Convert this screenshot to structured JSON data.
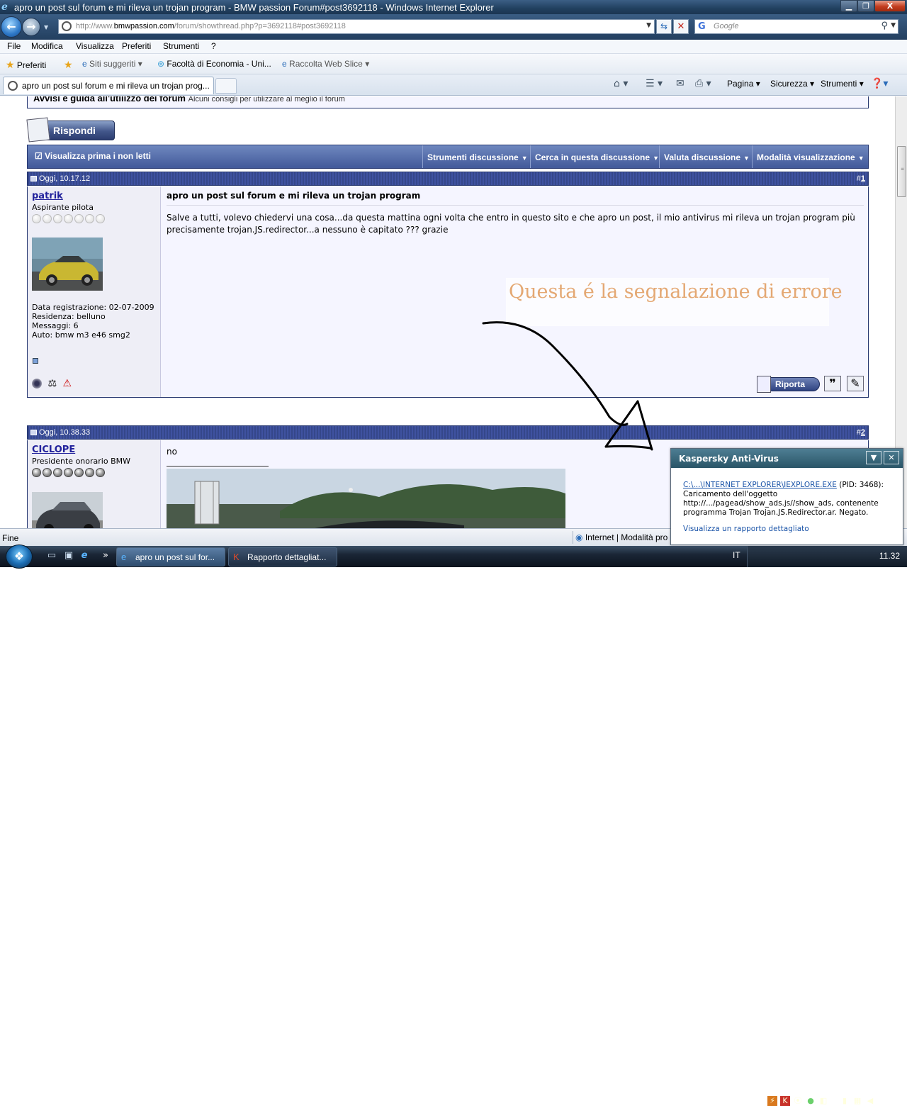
{
  "window": {
    "title": "apro un post sul forum e mi rileva un trojan program - BMW passion Forum#post3692118 - Windows Internet Explorer",
    "min": "▁",
    "max": "❐",
    "close": "X"
  },
  "address": {
    "url_prefix": "http://www.",
    "url_domain": "bmwpassion.com",
    "url_rest": "/forum/showthread.php?p=3692118#post3692118",
    "search_placeholder": "Google"
  },
  "menu": [
    "File",
    "Modifica",
    "Visualizza",
    "Preferiti",
    "Strumenti",
    "?"
  ],
  "favorites": {
    "preferiti": "Preferiti",
    "siti": "Siti suggeriti",
    "facolta": "Facoltà di Economia - Uni...",
    "raccolta": "Raccolta Web Slice"
  },
  "tab": {
    "label": "apro un post sul forum e mi rileva un trojan prog..."
  },
  "commands": {
    "pagina": "Pagina",
    "sicurezza": "Sicurezza",
    "strumenti": "Strumenti"
  },
  "forum": {
    "notice_title": "Avvisi e guida all'utilizzo del forum",
    "notice_sub": "Alcuni consigli per utilizzare al meglio il forum",
    "reply_label": "Rispondi",
    "threadbar": {
      "first": "Visualizza prima i non letti",
      "tools": "Strumenti discussione",
      "search": "Cerca in questa discussione",
      "rate": "Valuta discussione",
      "mode": "Modalità visualizzazione"
    },
    "posts": [
      {
        "date": "Oggi, 10.17.12",
        "num_prefix": "#",
        "num": "1",
        "user": "patrik",
        "rank": "Aspirante pilota",
        "info": [
          "Data registrazione: 02-07-2009",
          "Residenza: belluno",
          "Messaggi: 6",
          "Auto: bmw m3 e46 smg2"
        ],
        "title": "apro un post sul forum e mi rileva un trojan program",
        "body": "Salve a tutti, volevo chiedervi una cosa...da questa mattina ogni volta che entro in questo sito e che apro un post, il mio antivirus mi rileva un trojan program più precisamente trojan.JS.redirector...a nessuno è capitato ??? grazie",
        "report": "Riporta"
      },
      {
        "date": "Oggi, 10.38.33",
        "num_prefix": "#",
        "num": "2",
        "user": "CICLOPE",
        "rank": "Presidente onorario BMW",
        "body": "no"
      }
    ],
    "annotation": "Questa é la segnalazione di errore"
  },
  "status": {
    "text": "Fine",
    "zone": "Internet | Modalità pro"
  },
  "kaspersky": {
    "title": "Kaspersky Anti-Virus",
    "path_link": "C:\\...\\INTERNET EXPLORER\\IEXPLORE.EXE",
    "pid": " (PID: 3468):",
    "message": "Caricamento dell'oggetto http://.../pagead/show_ads.js//show_ads, contenente programma Trojan Trojan.JS.Redirector.ar. Negato.",
    "details": "Visualizza un rapporto dettagliato"
  },
  "taskbar": {
    "task1": "apro un post sul for...",
    "task2": "Rapporto dettagliat...",
    "lang": "IT",
    "clock": "11.32"
  },
  "colors": {
    "forum_blue": "#3f52a0",
    "annotation": "#e4a873",
    "kaspersky_header": "#2a5567"
  }
}
